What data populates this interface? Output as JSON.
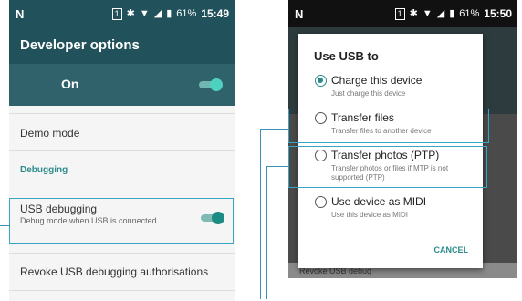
{
  "left_phone": {
    "status": {
      "carrier_icon": "N",
      "sim": "1",
      "battery_pct": "61%",
      "time": "15:49"
    },
    "app_title": "Developer options",
    "master_toggle": {
      "label": "On",
      "state": true
    },
    "demo_mode": "Demo mode",
    "section_debugging": "Debugging",
    "usb_debugging": {
      "title": "USB debugging",
      "subtitle": "Debug mode when USB is connected",
      "state": true
    },
    "revoke": "Revoke USB debugging authorisations"
  },
  "right_phone": {
    "status": {
      "carrier_icon": "N",
      "sim": "1",
      "battery_pct": "61%",
      "time": "15:50"
    },
    "dialog": {
      "title": "Use USB to",
      "options": [
        {
          "title": "Charge this device",
          "subtitle": "Just charge this device",
          "selected": true
        },
        {
          "title": "Transfer files",
          "subtitle": "Transfer files to another device",
          "selected": false
        },
        {
          "title": "Transfer photos (PTP)",
          "subtitle": "Transfer photos or files if MTP is not supported (PTP)",
          "selected": false
        },
        {
          "title": "Use device as MIDI",
          "subtitle": "Use this device as MIDI",
          "selected": false
        }
      ],
      "cancel": "CANCEL"
    },
    "background_hint": "Revoke USB debug"
  },
  "colors": {
    "teal_dark": "#21525b",
    "accent": "#2a8a8a",
    "highlight": "#3aa5c2"
  }
}
